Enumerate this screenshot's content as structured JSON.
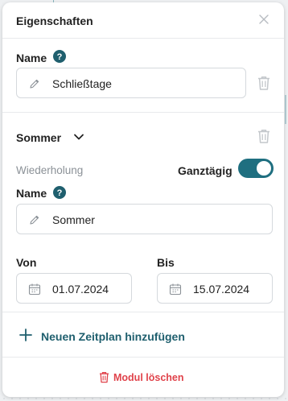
{
  "panel": {
    "title": "Eigenschaften",
    "close_icon": "close-icon"
  },
  "module": {
    "name_label": "Name",
    "name_value": "Schließtage",
    "help_icon": "question-circle-icon",
    "edit_icon": "pencil-icon",
    "delete_icon": "trash-icon"
  },
  "schedule": {
    "title": "Sommer",
    "expand_icon": "chevron-down-icon",
    "repeat_label": "Wiederholung",
    "allday_label": "Ganztägig",
    "allday_on": true,
    "name_label": "Name",
    "name_value": "Sommer",
    "from_label": "Von",
    "from_value": "01.07.2024",
    "to_label": "Bis",
    "to_value": "15.07.2024",
    "calendar_icon": "calendar-icon"
  },
  "actions": {
    "add_schedule": "Neuen Zeitplan hinzufügen",
    "delete_module": "Modul löschen"
  },
  "colors": {
    "accent": "#1f6f80",
    "accent_text": "#1f5f6e",
    "danger": "#e0434b",
    "muted": "#8b9197"
  }
}
